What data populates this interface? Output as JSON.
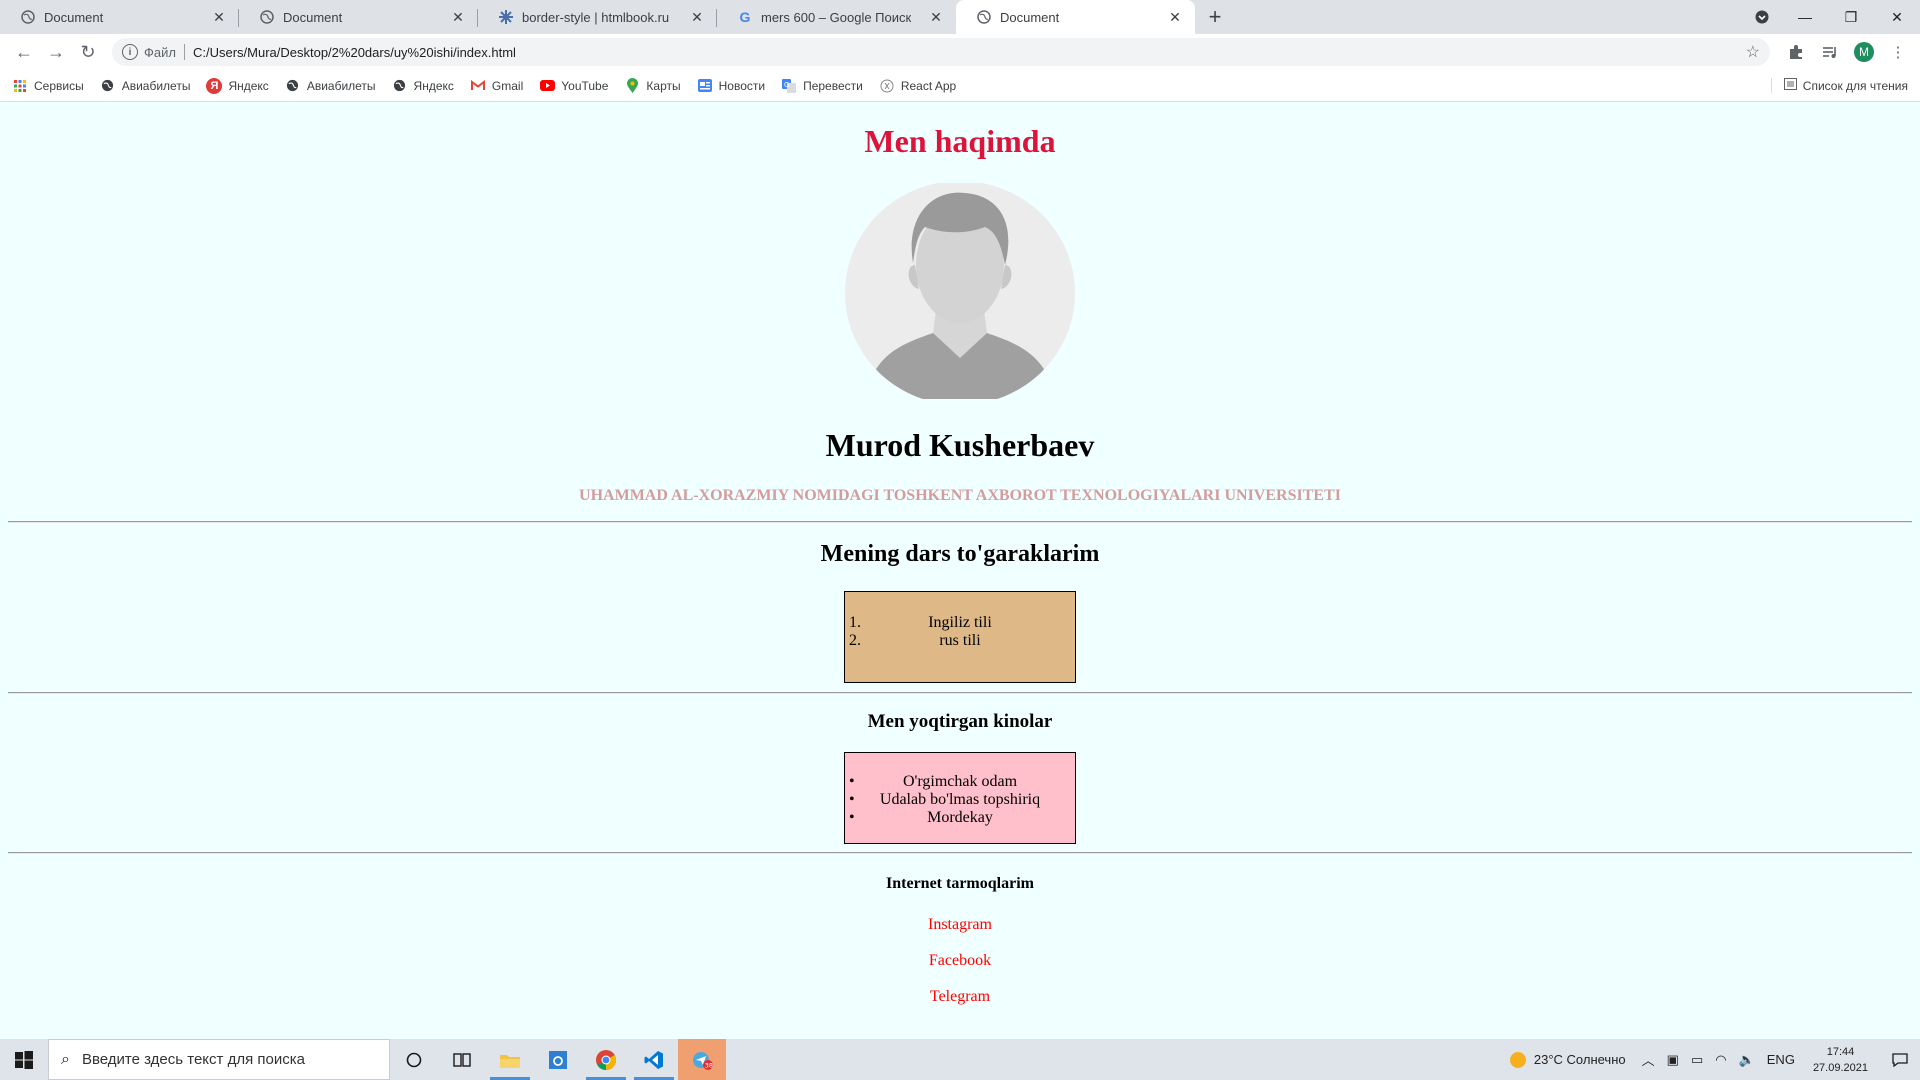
{
  "browser": {
    "tabs": [
      {
        "title": "Document",
        "icon": "globe-icon",
        "active": false
      },
      {
        "title": "Document",
        "icon": "globe-icon",
        "active": false
      },
      {
        "title": "border-style | htmlbook.ru",
        "icon": "htmlbook-icon",
        "active": false
      },
      {
        "title": "mers 600 – Google Поиск",
        "icon": "google-icon",
        "active": false
      },
      {
        "title": "Document",
        "icon": "globe-icon",
        "active": true
      }
    ],
    "address": {
      "scheme_label": "Файл",
      "url": "C:/Users/Mura/Desktop/2%20dars/uy%20ishi/index.html"
    },
    "profile_letter": "M",
    "bookmarks": [
      {
        "label": "Сервисы",
        "icon": "apps-grid-icon"
      },
      {
        "label": "Авиабилеты",
        "icon": "globe-icon"
      },
      {
        "label": "Яндекс",
        "icon": "yandex-icon"
      },
      {
        "label": "Авиабилеты",
        "icon": "globe-icon"
      },
      {
        "label": "Яндекс",
        "icon": "globe-icon"
      },
      {
        "label": "Gmail",
        "icon": "gmail-icon"
      },
      {
        "label": "YouTube",
        "icon": "youtube-icon"
      },
      {
        "label": "Карты",
        "icon": "maps-pin-icon"
      },
      {
        "label": "Новости",
        "icon": "news-icon"
      },
      {
        "label": "Перевести",
        "icon": "translate-icon"
      },
      {
        "label": "React App",
        "icon": "react-icon"
      }
    ],
    "reading_list": "Список для чтения"
  },
  "page": {
    "title": "Men haqimda",
    "name": "Murod Kusherbaev",
    "university": "UHAMMAD AL-XORAZMIY NOMIDAGI TOSHKENT AXBOROT TEXNOLOGIYALARI UNIVERSITETI",
    "courses_heading": "Mening dars to'garaklarim",
    "courses": [
      {
        "marker": "1.",
        "text": "Ingiliz tili"
      },
      {
        "marker": "2.",
        "text": "rus tili"
      }
    ],
    "movies_heading": "Men yoqtirgan kinolar",
    "movies": [
      {
        "marker": "•",
        "text": "O'rgimchak odam"
      },
      {
        "marker": "•",
        "text": "Udalab bo'lmas topshiriq"
      },
      {
        "marker": "•",
        "text": "Mordekay"
      }
    ],
    "networks_heading": "Internet tarmoqlarim",
    "links": [
      "Instagram",
      "Facebook",
      "Telegram"
    ],
    "colors": {
      "title": "#dc143c",
      "university": "#d59c9c",
      "courses_bg": "#deb887",
      "movies_bg": "#ffc0cb",
      "links": "#ff0000",
      "page_bg": "#f0ffff"
    }
  },
  "taskbar": {
    "search_placeholder": "Введите здесь текст для поиска",
    "weather": "23°C  Солнечно",
    "language": "ENG",
    "time": "17:44",
    "date": "27.09.2021",
    "mail_badge": "38"
  }
}
